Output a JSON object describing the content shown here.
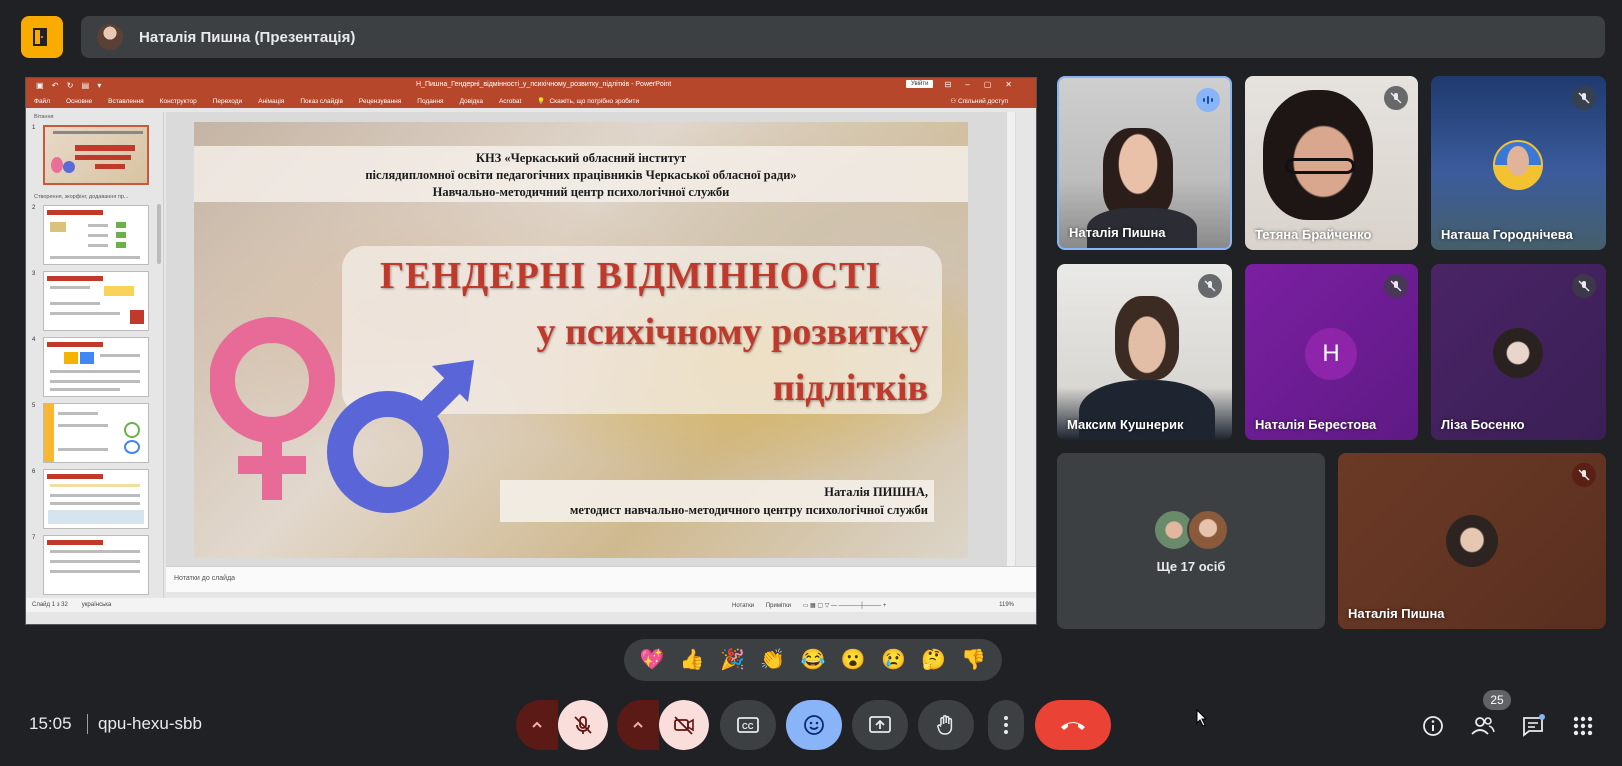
{
  "meeting": {
    "presenter_label": "Наталія Пишна (Презентація)",
    "time": "15:05",
    "code": "qpu-hexu-sbb",
    "participants_count": "25"
  },
  "ppt": {
    "title": "Н_Пишна_Гендерні_відмінності_у_психічному_розвитку_підлітків - PowerPoint",
    "signin": "Увійти",
    "menu": [
      "Файл",
      "Основне",
      "Вставлення",
      "Конструктор",
      "Переходи",
      "Анімація",
      "Показ слайдів",
      "Рецензування",
      "Подання",
      "Довідка",
      "Acrobat"
    ],
    "tell_me": "Скажіть, що потрібно зробити",
    "share": "Спільний доступ",
    "section_1": "Вітання",
    "section_2": "Створення, зкорфінг, додавання пр...",
    "notes_placeholder": "Нотатки до слайда",
    "status_slide": "Слайд 1 з 32",
    "status_lang": "українська",
    "status_notes": "Нотатки",
    "status_comments": "Примітки",
    "zoom": "119%",
    "thumb_numbers": [
      "1",
      "2",
      "3",
      "4",
      "5",
      "6",
      "7"
    ]
  },
  "slide": {
    "header_line1": "КНЗ «Черкаський обласний інститут",
    "header_line2": "післядипломної освіти педагогічних працівників Черкаської обласної ради»",
    "header_line3": "Навчально-методичний центр психологічної служби",
    "title_line1": "ГЕНДЕРНІ ВІДМІННОСТІ",
    "title_line2": "у психічному розвитку",
    "title_line3": "підлітків",
    "author_line1": "Наталія ПИШНА,",
    "author_line2": "методист навчально-методичного центру психологічної служби"
  },
  "participants": [
    {
      "name": "Наталія Пишна"
    },
    {
      "name": "Тетяна Брайченко"
    },
    {
      "name": "Наташа Городнічева"
    },
    {
      "name": "Максим Кушнерик"
    },
    {
      "name": "Наталія Берестова",
      "initial": "Н"
    },
    {
      "name": "Ліза Босенко"
    },
    {
      "name": "Ще 17 осіб"
    },
    {
      "name": "Наталія Пишна"
    }
  ],
  "reactions": [
    "💖",
    "👍",
    "🎉",
    "👏",
    "😂",
    "😮",
    "😢",
    "🤔",
    "👎"
  ],
  "colors": {
    "background": "#202124",
    "panel": "#3c4043",
    "hangup": "#ea4335",
    "active_blue": "#8ab4f8",
    "ppt_red": "#b7472a",
    "slide_title_red": "#c0392b",
    "logo_yellow": "#f9ab00"
  },
  "icons": [
    "exit-icon",
    "mic-off-icon",
    "camera-off-icon",
    "captions-icon",
    "emoji-icon",
    "present-icon",
    "raise-hand-icon",
    "more-icon",
    "hangup-icon",
    "info-icon",
    "people-icon",
    "chat-icon",
    "activities-icon"
  ]
}
